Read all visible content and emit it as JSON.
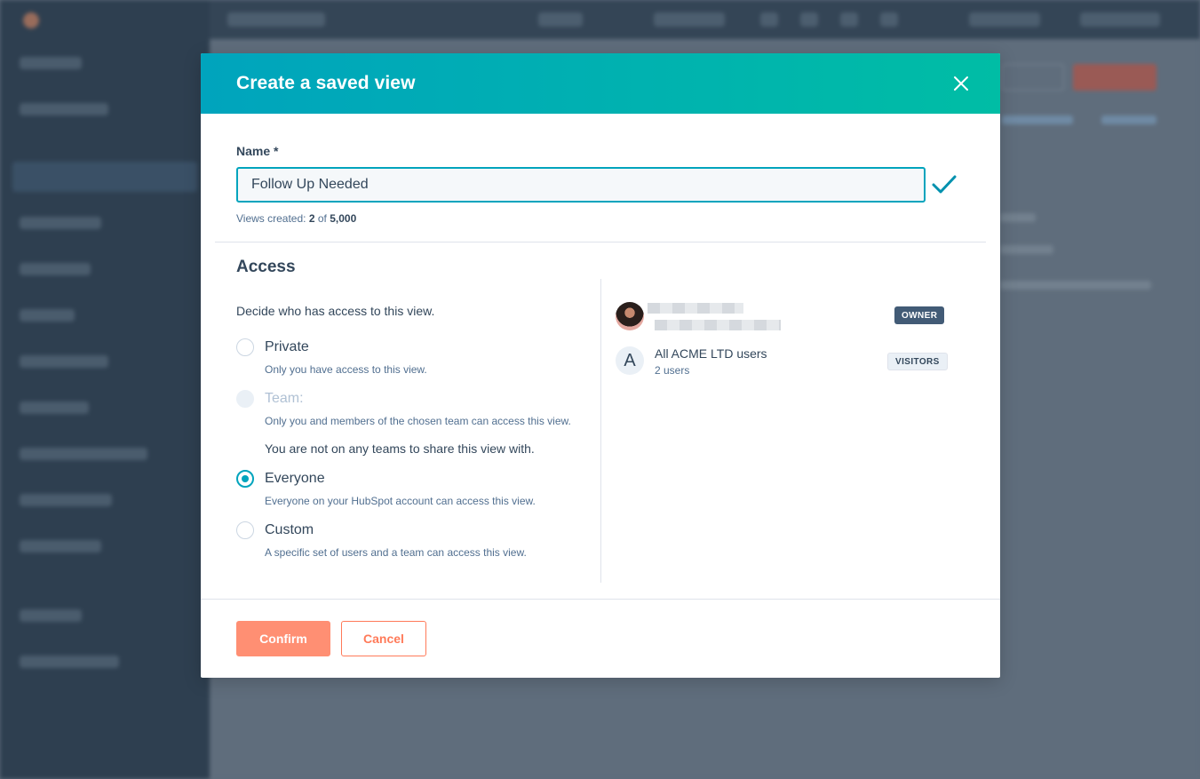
{
  "modal": {
    "title": "Create a saved view",
    "name_field": {
      "label": "Name *",
      "value": "Follow Up Needed"
    },
    "views_created": {
      "prefix": "Views created:",
      "count": "2",
      "of": "of",
      "limit": "5,000"
    },
    "access": {
      "title": "Access",
      "description": "Decide who has access to this view.",
      "options": [
        {
          "label": "Private",
          "help": "Only you have access to this view.",
          "checked": false,
          "disabled": false
        },
        {
          "label": "Team:",
          "help": "Only you and members of the chosen team can access this view.",
          "checked": false,
          "disabled": true
        },
        {
          "label": "Everyone",
          "help": "Everyone on your HubSpot account can access this view.",
          "checked": true,
          "disabled": false
        },
        {
          "label": "Custom",
          "help": "A specific set of users and a team can access this view.",
          "checked": false,
          "disabled": false
        }
      ],
      "team_note": "You are not on any teams to share this view with.",
      "members": [
        {
          "name": "",
          "badge": "OWNER"
        },
        {
          "avatar_letter": "A",
          "name": "All ACME LTD users",
          "sub": "2 users",
          "badge": "VISITORS"
        }
      ]
    },
    "footer": {
      "confirm_label": "Confirm",
      "cancel_label": "Cancel"
    }
  },
  "colors": {
    "header_gradient_start": "#00a4bd",
    "header_gradient_end": "#00bda5",
    "accent": "#00a4bd",
    "confirm_button": "#ff8f73",
    "cancel_border": "#ff7a59",
    "owner_badge": "#425b76"
  }
}
